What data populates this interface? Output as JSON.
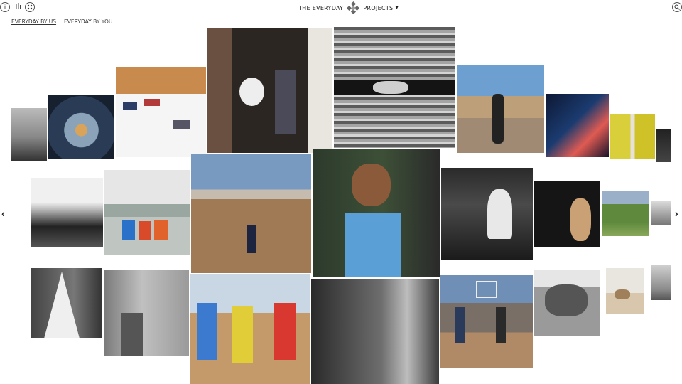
{
  "header": {
    "brand_left": "THE EVERYDAY",
    "brand_right": "PROJECTS",
    "info_icon": "info-icon",
    "grid_view_icon": "grid-view-icon",
    "list_view_icon": "list-view-icon",
    "search_icon": "search-icon"
  },
  "tabs": [
    {
      "label": "EVERYDAY BY US",
      "active": true
    },
    {
      "label": "EVERYDAY BY YOU",
      "active": false
    }
  ],
  "gallery": {
    "prev_icon": "chevron-left-icon",
    "next_icon": "chevron-right-icon",
    "photos": [
      {
        "name": "capitol-photo"
      },
      {
        "name": "circular-metal-structure-photo"
      },
      {
        "name": "snow-angels-photo"
      },
      {
        "name": "women-sitting-photo"
      },
      {
        "name": "children-peeking-through-fence-photo"
      },
      {
        "name": "armed-man-street-photo"
      },
      {
        "name": "neon-city-photo"
      },
      {
        "name": "yellow-figures-photo"
      },
      {
        "name": "dark-edge-photo"
      },
      {
        "name": "misty-lake-photo"
      },
      {
        "name": "boys-sitting-photo"
      },
      {
        "name": "desert-motocross-photo"
      },
      {
        "name": "boy-in-fence-photo"
      },
      {
        "name": "veiled-women-photo"
      },
      {
        "name": "man-portrait-photo"
      },
      {
        "name": "green-hills-photo"
      },
      {
        "name": "small-figure-photo"
      },
      {
        "name": "kkk-hood-trump-photo"
      },
      {
        "name": "boy-with-bottles-photo"
      },
      {
        "name": "running-girls-photo"
      },
      {
        "name": "girl-at-window-photo"
      },
      {
        "name": "basketball-hoop-photo"
      },
      {
        "name": "wrestlers-photo"
      },
      {
        "name": "camels-photo"
      },
      {
        "name": "shore-figures-photo"
      }
    ]
  }
}
